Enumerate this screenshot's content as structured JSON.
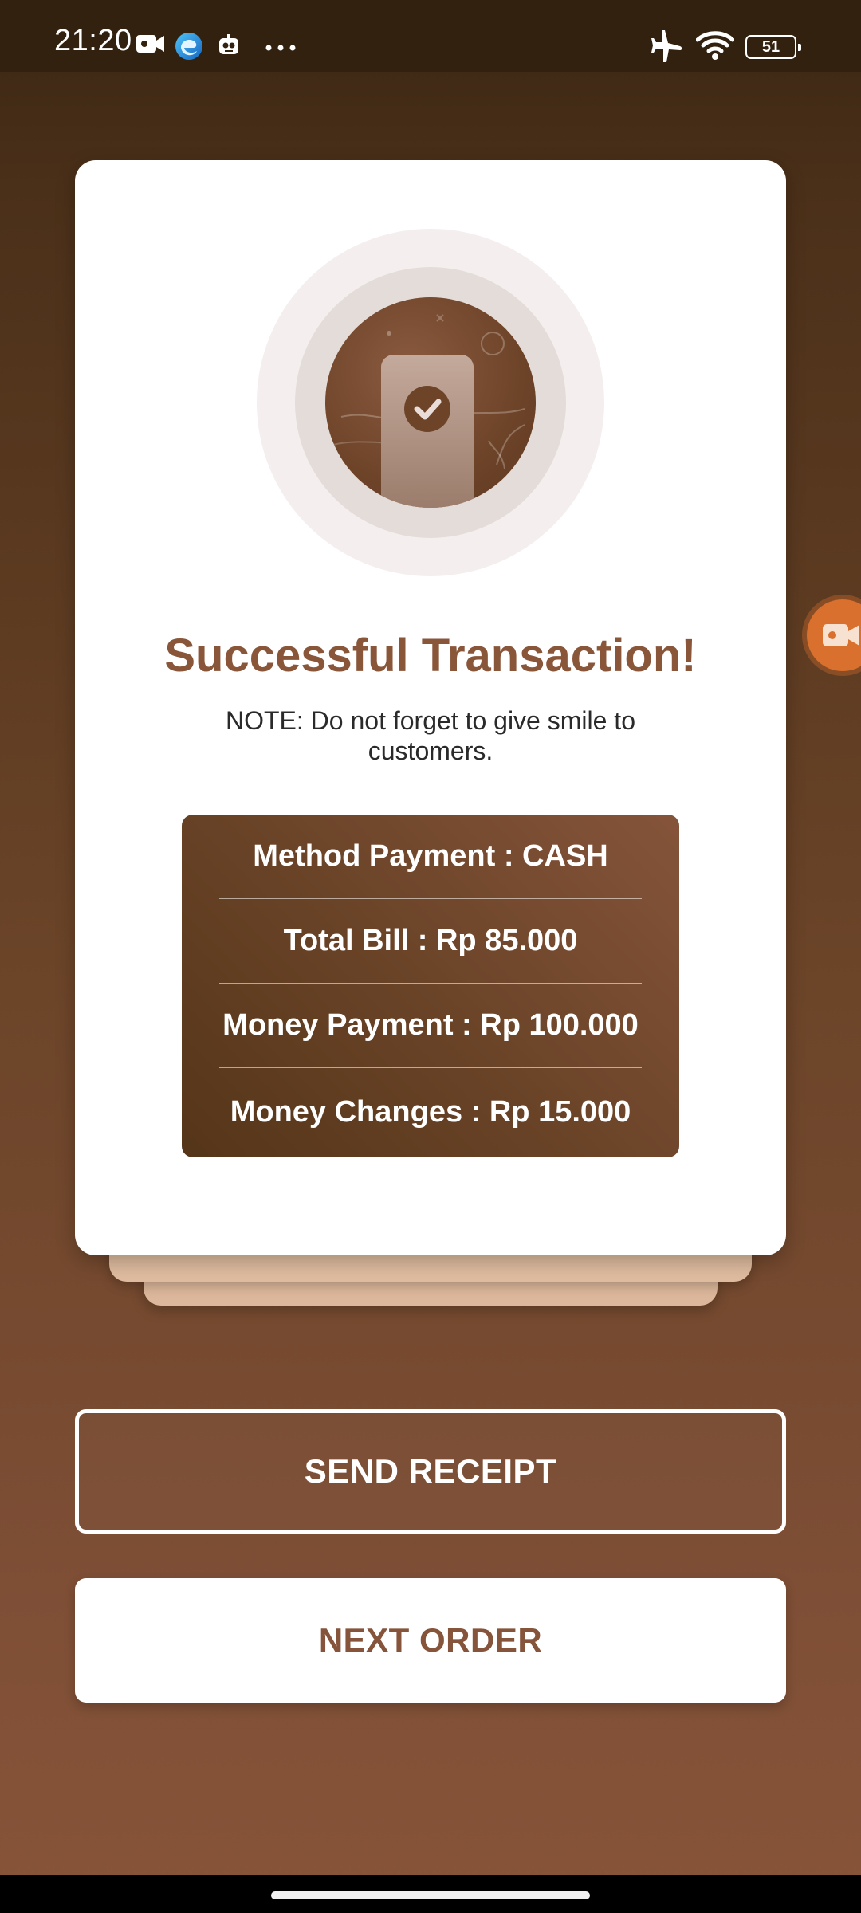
{
  "status_bar": {
    "time": "21:20",
    "left_icons": [
      "video-camera-icon",
      "edge-browser-icon",
      "bot-app-icon",
      "more-dots-icon"
    ],
    "right_icons": [
      "airplane-mode-icon",
      "wifi-icon",
      "battery-icon"
    ],
    "battery_level": "51"
  },
  "card": {
    "illustration": "phone-checkmark-icon",
    "title": "Successful Transaction!",
    "note": "NOTE: Do not forget to give smile to customers.",
    "summary": [
      {
        "label": "Method Payment : CASH"
      },
      {
        "label": "Total Bill : Rp 85.000"
      },
      {
        "label": "Money Payment : Rp 100.000"
      },
      {
        "label": "Money Changes : Rp 15.000"
      }
    ]
  },
  "buttons": {
    "send_receipt": "SEND RECEIPT",
    "next_order": "NEXT ORDER"
  },
  "colors": {
    "accent": "#8a563a",
    "background_top": "#3a2613",
    "background_bottom": "#875438",
    "card": "#ffffff",
    "summary_panel": "#6b4428"
  },
  "floating_button": {
    "icon": "screen-recorder-icon"
  }
}
